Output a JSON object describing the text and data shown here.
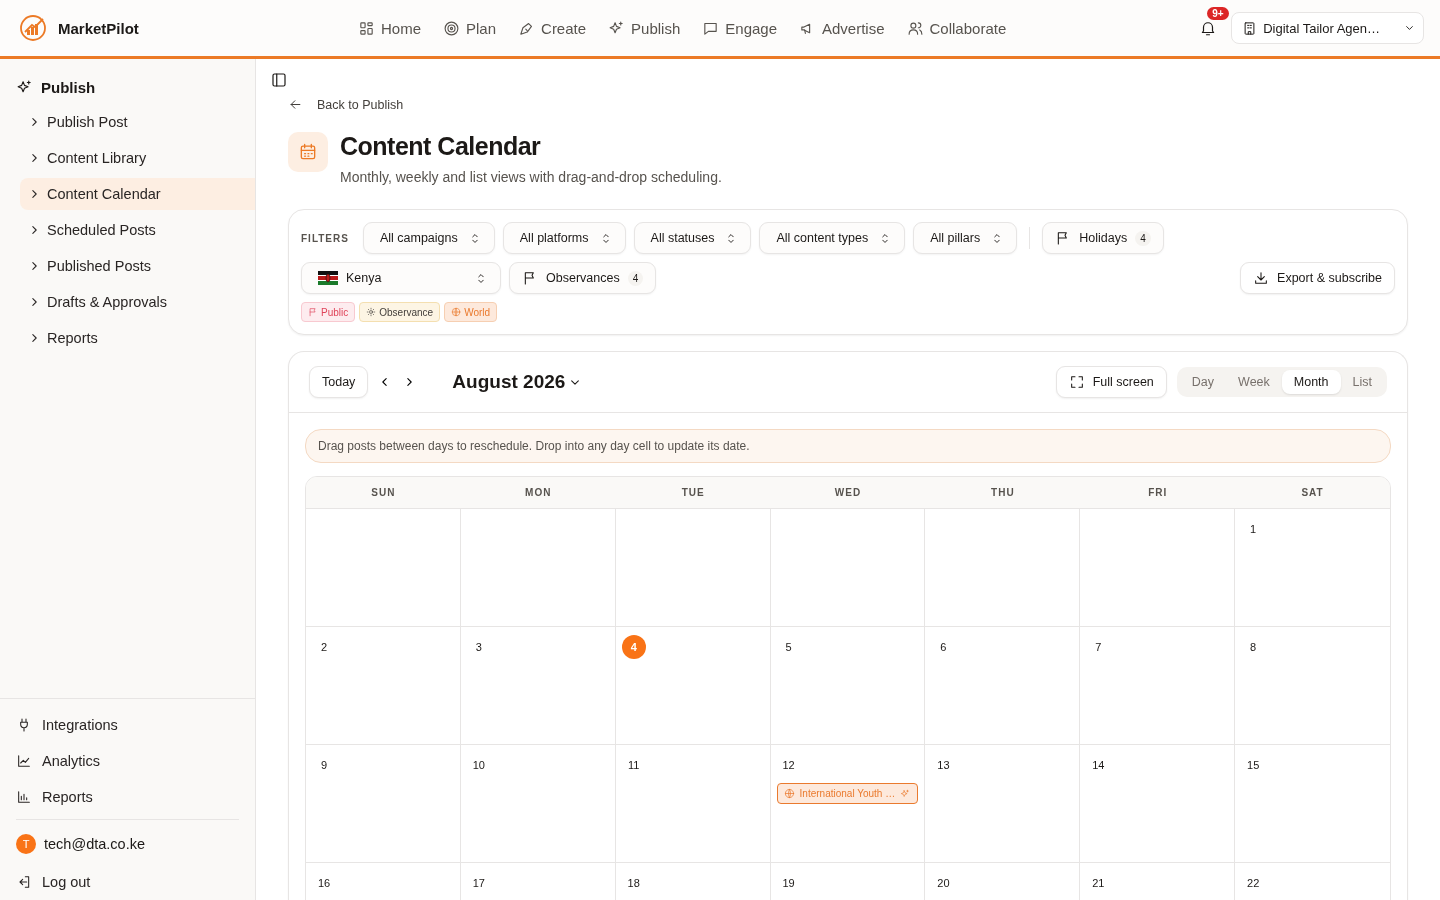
{
  "brand": {
    "name": "MarketPilot"
  },
  "top_nav": [
    {
      "label": "Home"
    },
    {
      "label": "Plan"
    },
    {
      "label": "Create"
    },
    {
      "label": "Publish"
    },
    {
      "label": "Engage"
    },
    {
      "label": "Advertise"
    },
    {
      "label": "Collaborate"
    }
  ],
  "notifications": {
    "badge": "9+"
  },
  "workspace": {
    "name": "Digital Tailor Agen…"
  },
  "sidebar": {
    "section": "Publish",
    "items": [
      {
        "label": "Publish Post",
        "selected": false
      },
      {
        "label": "Content Library",
        "selected": false
      },
      {
        "label": "Content Calendar",
        "selected": true
      },
      {
        "label": "Scheduled Posts",
        "selected": false
      },
      {
        "label": "Published Posts",
        "selected": false
      },
      {
        "label": "Drafts & Approvals",
        "selected": false
      },
      {
        "label": "Reports",
        "selected": false
      }
    ],
    "bottom_items": [
      {
        "label": "Integrations"
      },
      {
        "label": "Analytics"
      },
      {
        "label": "Reports"
      }
    ],
    "user": {
      "initial": "T",
      "email": "tech@dta.co.ke"
    },
    "logout": "Log out"
  },
  "back_link": "Back to Publish",
  "page": {
    "title": "Content Calendar",
    "subtitle": "Monthly, weekly and list views with drag-and-drop scheduling."
  },
  "filters": {
    "label": "FILTERS",
    "selects": [
      {
        "value": "All campaigns"
      },
      {
        "value": "All platforms"
      },
      {
        "value": "All statuses"
      },
      {
        "value": "All content types"
      },
      {
        "value": "All pillars"
      }
    ],
    "holidays": {
      "label": "Holidays",
      "count": "4"
    },
    "country": {
      "value": "Kenya"
    },
    "observances": {
      "label": "Observances",
      "count": "4"
    },
    "export": "Export & subscribe",
    "legend": [
      {
        "label": "Public",
        "kind": "public"
      },
      {
        "label": "Observance",
        "kind": "observance"
      },
      {
        "label": "World",
        "kind": "world"
      }
    ]
  },
  "calendar": {
    "today_button": "Today",
    "month": "August 2026",
    "fullscreen": "Full screen",
    "views": [
      {
        "label": "Day",
        "selected": false
      },
      {
        "label": "Week",
        "selected": false
      },
      {
        "label": "Month",
        "selected": true
      },
      {
        "label": "List",
        "selected": false
      }
    ],
    "notice": "Drag posts between days to reschedule. Drop into any day cell to update its date.",
    "weekdays": [
      "SUN",
      "MON",
      "TUE",
      "WED",
      "THU",
      "FRI",
      "SAT"
    ],
    "weeks": [
      [
        {
          "kind": "blank"
        },
        {
          "kind": "blank"
        },
        {
          "kind": "blank"
        },
        {
          "kind": "blank"
        },
        {
          "kind": "blank"
        },
        {
          "kind": "blank"
        },
        {
          "kind": "day",
          "day": "1",
          "today": false
        }
      ],
      [
        {
          "kind": "day",
          "day": "2",
          "today": false
        },
        {
          "kind": "day",
          "day": "3",
          "today": false
        },
        {
          "kind": "day",
          "day": "4",
          "today": true
        },
        {
          "kind": "day",
          "day": "5",
          "today": false
        },
        {
          "kind": "day",
          "day": "6",
          "today": false
        },
        {
          "kind": "day",
          "day": "7",
          "today": false
        },
        {
          "kind": "day",
          "day": "8",
          "today": false
        }
      ],
      [
        {
          "kind": "day",
          "day": "9",
          "today": false
        },
        {
          "kind": "day",
          "day": "10",
          "today": false
        },
        {
          "kind": "day",
          "day": "11",
          "today": false
        },
        {
          "kind": "day",
          "day": "12",
          "today": false,
          "events": [
            {
              "label": "International Youth …",
              "kind": "world"
            }
          ]
        },
        {
          "kind": "day",
          "day": "13",
          "today": false
        },
        {
          "kind": "day",
          "day": "14",
          "today": false
        },
        {
          "kind": "day",
          "day": "15",
          "today": false
        }
      ],
      [
        {
          "kind": "day",
          "day": "16",
          "today": false
        },
        {
          "kind": "day",
          "day": "17",
          "today": false
        },
        {
          "kind": "day",
          "day": "18",
          "today": false
        },
        {
          "kind": "day",
          "day": "19",
          "today": false
        },
        {
          "kind": "day",
          "day": "20",
          "today": false
        },
        {
          "kind": "day",
          "day": "21",
          "today": false
        },
        {
          "kind": "day",
          "day": "22",
          "today": false
        }
      ]
    ]
  }
}
